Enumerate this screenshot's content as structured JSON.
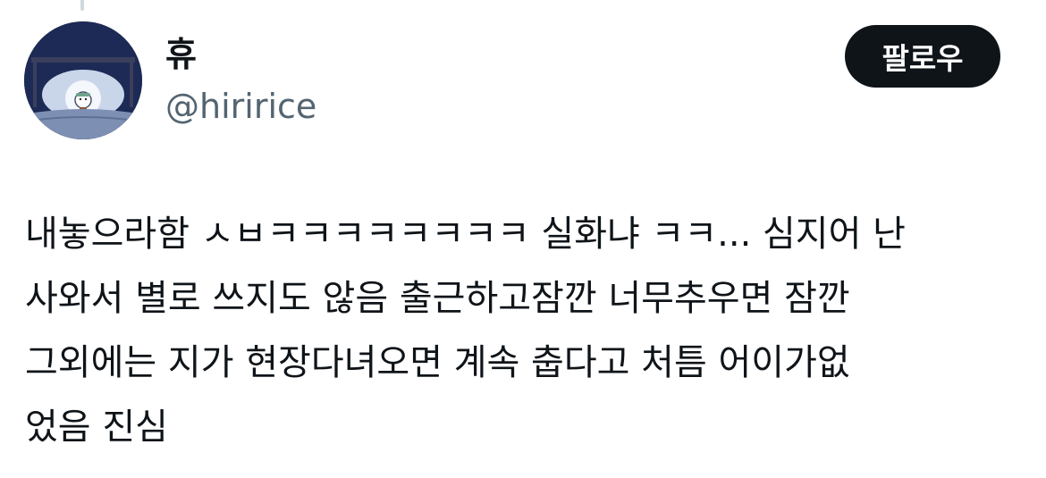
{
  "author": {
    "display_name": "휴",
    "handle": "@hiririce",
    "avatar": "avatar-sleeping-character-icon"
  },
  "follow_button": {
    "label": "팔로우"
  },
  "tweet": {
    "lines": [
      "내놓으라함 ㅅㅂㅋㅋㅋㅋㅋㅋㅋㅋ 실화냐 ㅋㅋ... 심지어 난",
      "사와서 별로 쓰지도 않음 출근하고잠깐 너무추우면 잠깐",
      "그외에는 지가 현장다녀오면 계속 춥다고 처틈 어이가없",
      "었음 진심"
    ]
  },
  "colors": {
    "primary_text": "#0f1419",
    "secondary_text": "#536471",
    "button_bg": "#0f1419",
    "button_text": "#ffffff",
    "thread_line": "#cfd9de"
  }
}
